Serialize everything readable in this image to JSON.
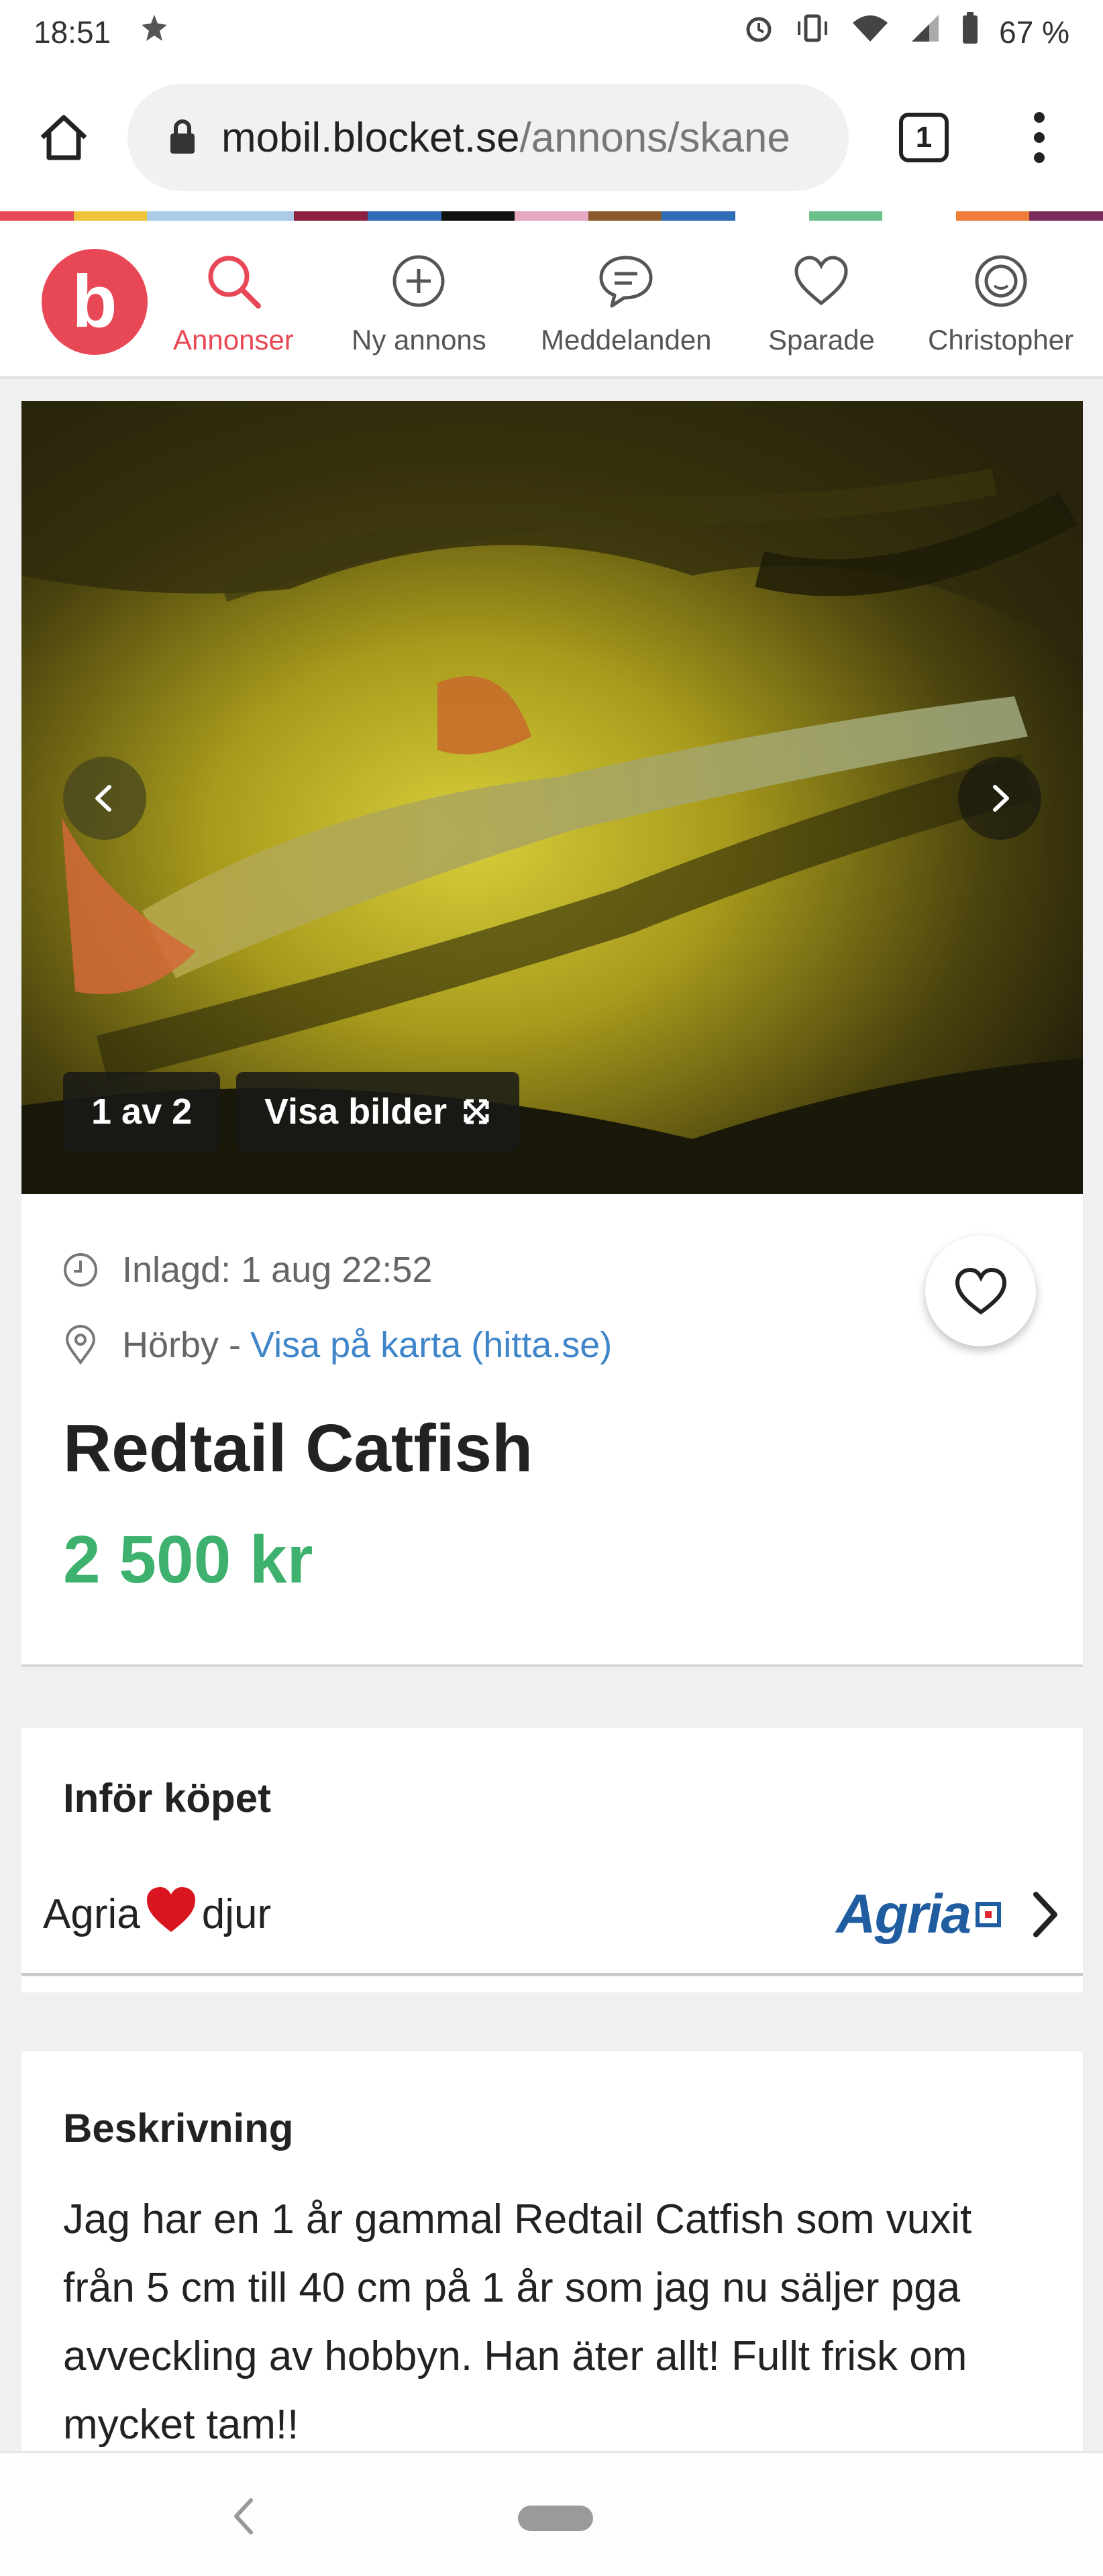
{
  "status_bar": {
    "time": "18:51",
    "battery": "67 %"
  },
  "browser": {
    "url_domain": "mobil.blocket.se",
    "url_path": "/annons/skane",
    "tab_count": "1"
  },
  "stripe_colors": [
    "#e84855",
    "#f0c33c",
    "#a9cbe8",
    "#a9cbe8",
    "#8b2040",
    "#2f6db5",
    "#111111",
    "#e5a9c2",
    "#8a5a2b",
    "#2f6db5",
    "#ffffff",
    "#6cc08b",
    "#ffffff",
    "#ef7d3a",
    "#7c2b5a"
  ],
  "app_nav": {
    "logo_letter": "b",
    "items": [
      {
        "label": "Annonser",
        "icon": "search-icon",
        "active": true
      },
      {
        "label": "Ny annons",
        "icon": "plus-circle-icon",
        "active": false
      },
      {
        "label": "Meddelanden",
        "icon": "chat-icon",
        "active": false
      },
      {
        "label": "Sparade",
        "icon": "heart-icon",
        "active": false
      },
      {
        "label": "Christopher",
        "icon": "profile-icon",
        "active": false
      }
    ],
    "accent_color": "#e84855"
  },
  "gallery": {
    "counter": "1 av 2",
    "show_images_label": "Visa bilder"
  },
  "ad": {
    "posted": "Inlagd: 1 aug 22:52",
    "location": "Hörby -",
    "map_link": "Visa på karta (hitta.se)",
    "title": "Redtail Catfish",
    "price": "2 500 kr",
    "price_color": "#3db16d"
  },
  "before_purchase": {
    "title": "Inför köpet",
    "agria_text_before": "Agria",
    "agria_text_after": "djur",
    "agria_logo_text": "Agria"
  },
  "description": {
    "title": "Beskrivning",
    "text": "Jag har en 1 år gammal Redtail Catfish som vuxit från 5 cm till 40 cm på 1 år som jag nu säljer pga avveckling av hobbyn. Han äter allt! Fullt frisk om mycket tam!!"
  }
}
